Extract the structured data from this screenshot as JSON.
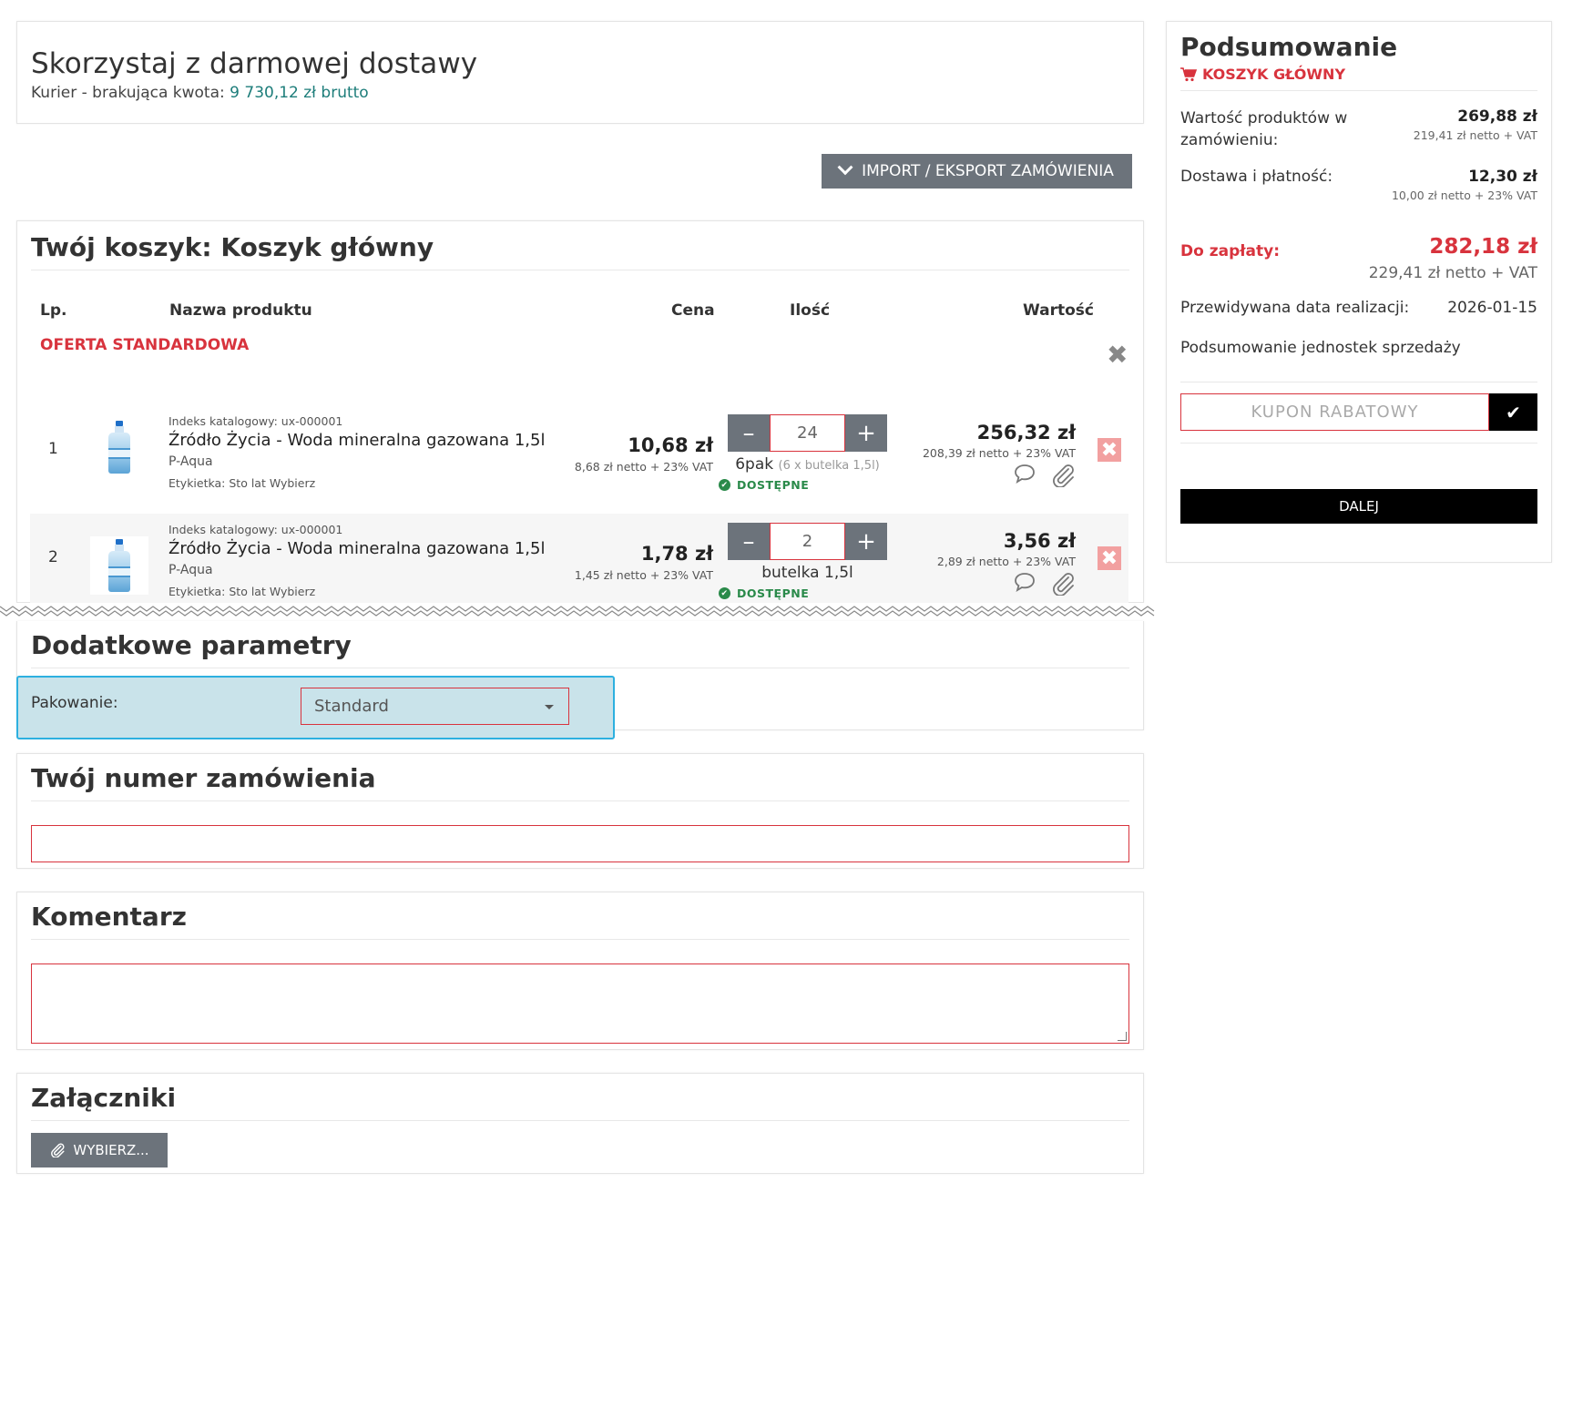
{
  "free_delivery": {
    "title": "Skorzystaj z darmowej dostawy",
    "label": "Kurier - brakująca kwota:",
    "amount": "9 730,12 zł brutto"
  },
  "import_button": "IMPORT / EKSPORT ZAMÓWIENIA",
  "cart": {
    "title": "Twój koszyk: Koszyk główny",
    "columns": {
      "lp": "Lp.",
      "name": "Nazwa produktu",
      "price": "Cena",
      "qty": "Ilość",
      "value": "Wartość"
    },
    "offer": "OFERTA STANDARDOWA",
    "items": [
      {
        "lp": "1",
        "index": "Indeks katalogowy: ux-000001",
        "name": "Źródło Życia - Woda mineralna gazowana 1,5l",
        "brand": "P-Aqua",
        "label": "Etykietka: Sto lat Wybierz",
        "price": "10,68 zł",
        "price_net": "8,68 zł netto + 23% VAT",
        "qty": "24",
        "unit": "6pak",
        "unit_detail": "(6 x butelka 1,5l)",
        "availability": "DOSTĘPNE",
        "value": "256,32 zł",
        "value_net": "208,39 zł netto + 23% VAT"
      },
      {
        "lp": "2",
        "index": "Indeks katalogowy: ux-000001",
        "name": "Źródło Życia - Woda mineralna gazowana 1,5l",
        "brand": "P-Aqua",
        "label": "Etykietka: Sto lat Wybierz",
        "price": "1,78 zł",
        "price_net": "1,45 zł netto + 23% VAT",
        "qty": "2",
        "unit": "butelka 1,5l",
        "unit_detail": "",
        "availability": "DOSTĘPNE",
        "value": "3,56 zł",
        "value_net": "2,89 zł netto + 23% VAT"
      }
    ]
  },
  "params": {
    "title": "Dodatkowe parametry",
    "packing_label": "Pakowanie:",
    "packing_value": "Standard"
  },
  "order_number": {
    "title": "Twój numer zamówienia"
  },
  "comment": {
    "title": "Komentarz"
  },
  "attachments": {
    "title": "Załączniki",
    "button": "WYBIERZ..."
  },
  "summary": {
    "title": "Podsumowanie",
    "cart_name": "KOSZYK GŁÓWNY",
    "products_label": "Wartość produktów w zamówieniu:",
    "products_value": "269,88 zł",
    "products_net": "219,41 zł netto + VAT",
    "delivery_label": "Dostawa i płatność:",
    "delivery_value": "12,30 zł",
    "delivery_net": "10,00 zł netto + 23% VAT",
    "topay_label": "Do zapłaty:",
    "topay_value": "282,18 zł",
    "topay_net": "229,41 zł netto + VAT",
    "date_label": "Przewidywana data realizacji:",
    "date_value": "2026-01-15",
    "units_label": "Podsumowanie jednostek sprzedaży",
    "coupon_placeholder": "KUPON RABATOWY",
    "next_button": "DALEJ"
  },
  "colors": {
    "accent_red": "#d8333d",
    "button_gray": "#6c737b",
    "available_green": "#2a8a4a",
    "highlight": "#c9e3ea"
  }
}
